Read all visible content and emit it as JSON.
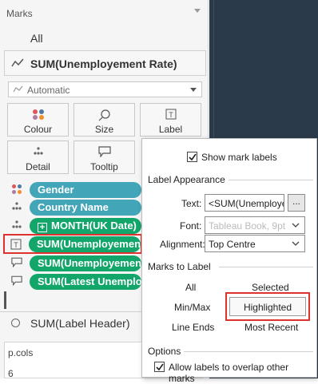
{
  "marks": {
    "title": "Marks",
    "all_label": "All",
    "series_label": "SUM(Unemployement Rate)",
    "mark_type": "Automatic",
    "buttons": [
      {
        "label": "Colour",
        "icon": "colour-dots-icon"
      },
      {
        "label": "Size",
        "icon": "size-icon"
      },
      {
        "label": "Label",
        "icon": "text-label-icon"
      },
      {
        "label": "Detail",
        "icon": "detail-dots-icon"
      },
      {
        "label": "Tooltip",
        "icon": "tooltip-icon"
      }
    ],
    "pills": [
      {
        "label": "Gender",
        "icon": "colour-dots-icon",
        "color": "#43a5b8"
      },
      {
        "label": "Country Name",
        "icon": "detail-dots-icon",
        "color": "#43a5b8"
      },
      {
        "label": "MONTH(UK Date)",
        "icon": "detail-dots-icon",
        "color": "#13a66b"
      },
      {
        "label": "SUM(Unemployement Rate)",
        "icon": "text-label-icon",
        "color": "#13a66b"
      },
      {
        "label": "SUM(Unemployement Rate)",
        "icon": "tooltip-icon",
        "color": "#13a66b"
      },
      {
        "label": "SUM(Latest Unemployment)",
        "icon": "tooltip-icon",
        "color": "#13a66b"
      }
    ],
    "label_header": "SUM(Label Header)"
  },
  "params": {
    "title": "p.cols",
    "value": "6"
  },
  "label_popup": {
    "show_labels_text": "Show mark labels",
    "show_labels_checked": true,
    "appearance_title": "Label Appearance",
    "text_label": "Text:",
    "text_value": "<SUM(Unemployement Rate)>",
    "dots_label": "...",
    "font_label": "Font:",
    "font_value": "Tableau Book, 9pt",
    "alignment_label": "Alignment:",
    "alignment_value": "Top Centre",
    "marks_to_label_title": "Marks to Label",
    "options": {
      "all": "All",
      "selected": "Selected",
      "minmax": "Min/Max",
      "highlighted": "Highlighted",
      "line_ends": "Line Ends",
      "most_recent": "Most Recent"
    },
    "options_title": "Options",
    "overlap_text": "Allow labels to overlap other marks",
    "overlap_checked": true
  },
  "colors": {
    "pill_blue": "#43a5b8",
    "pill_green": "#13a66b",
    "highlight_box": "#e03131",
    "dark_bg": "#2b3a4a"
  }
}
